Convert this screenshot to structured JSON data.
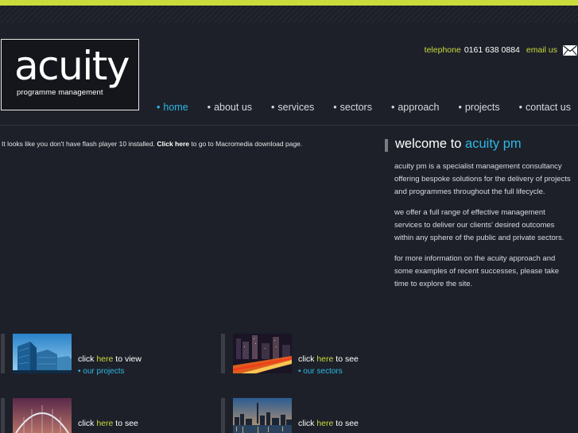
{
  "logo": {
    "word": "acuity",
    "sub": "programme management"
  },
  "contact": {
    "telephone_label": "telephone",
    "telephone_number": "0161 638 0884",
    "email_label": "email us"
  },
  "nav": [
    {
      "label": "home"
    },
    {
      "label": "about us"
    },
    {
      "label": "services"
    },
    {
      "label": "sectors"
    },
    {
      "label": "approach"
    },
    {
      "label": "projects"
    },
    {
      "label": "contact us"
    }
  ],
  "flash": {
    "before": "It looks like you don't have flash player 10 installed.",
    "link": "Click here",
    "after": "to go to Macromedia download page."
  },
  "welcome": {
    "title_prefix": "welcome to",
    "title_highlight": "acuity pm",
    "paragraphs": [
      "acuity pm is a specialist management consultancy offering bespoke solutions for the delivery of projects and programmes throughout the full lifecycle.",
      "we offer a full range of effective management services to deliver our clients' desired outcomes within any sphere of the public and private sectors.",
      "for more information on the acuity approach and some examples of recent successes, please take time to explore the site."
    ]
  },
  "tiles": [
    {
      "click": "click",
      "here": "here",
      "action": "to view",
      "link": "• our projects"
    },
    {
      "click": "click",
      "here": "here",
      "action": "to see",
      "link": "• our sectors"
    },
    {
      "click": "click",
      "here": "here",
      "action": "to see",
      "link": ""
    },
    {
      "click": "click",
      "here": "here",
      "action": "to see",
      "link": ""
    }
  ],
  "colors": {
    "background": "#1d2029",
    "accent_green": "#c9dc3c",
    "accent_blue": "#2db8e3",
    "text": "#d9dbe0"
  },
  "icons": {
    "contact": "envelope-icon"
  }
}
